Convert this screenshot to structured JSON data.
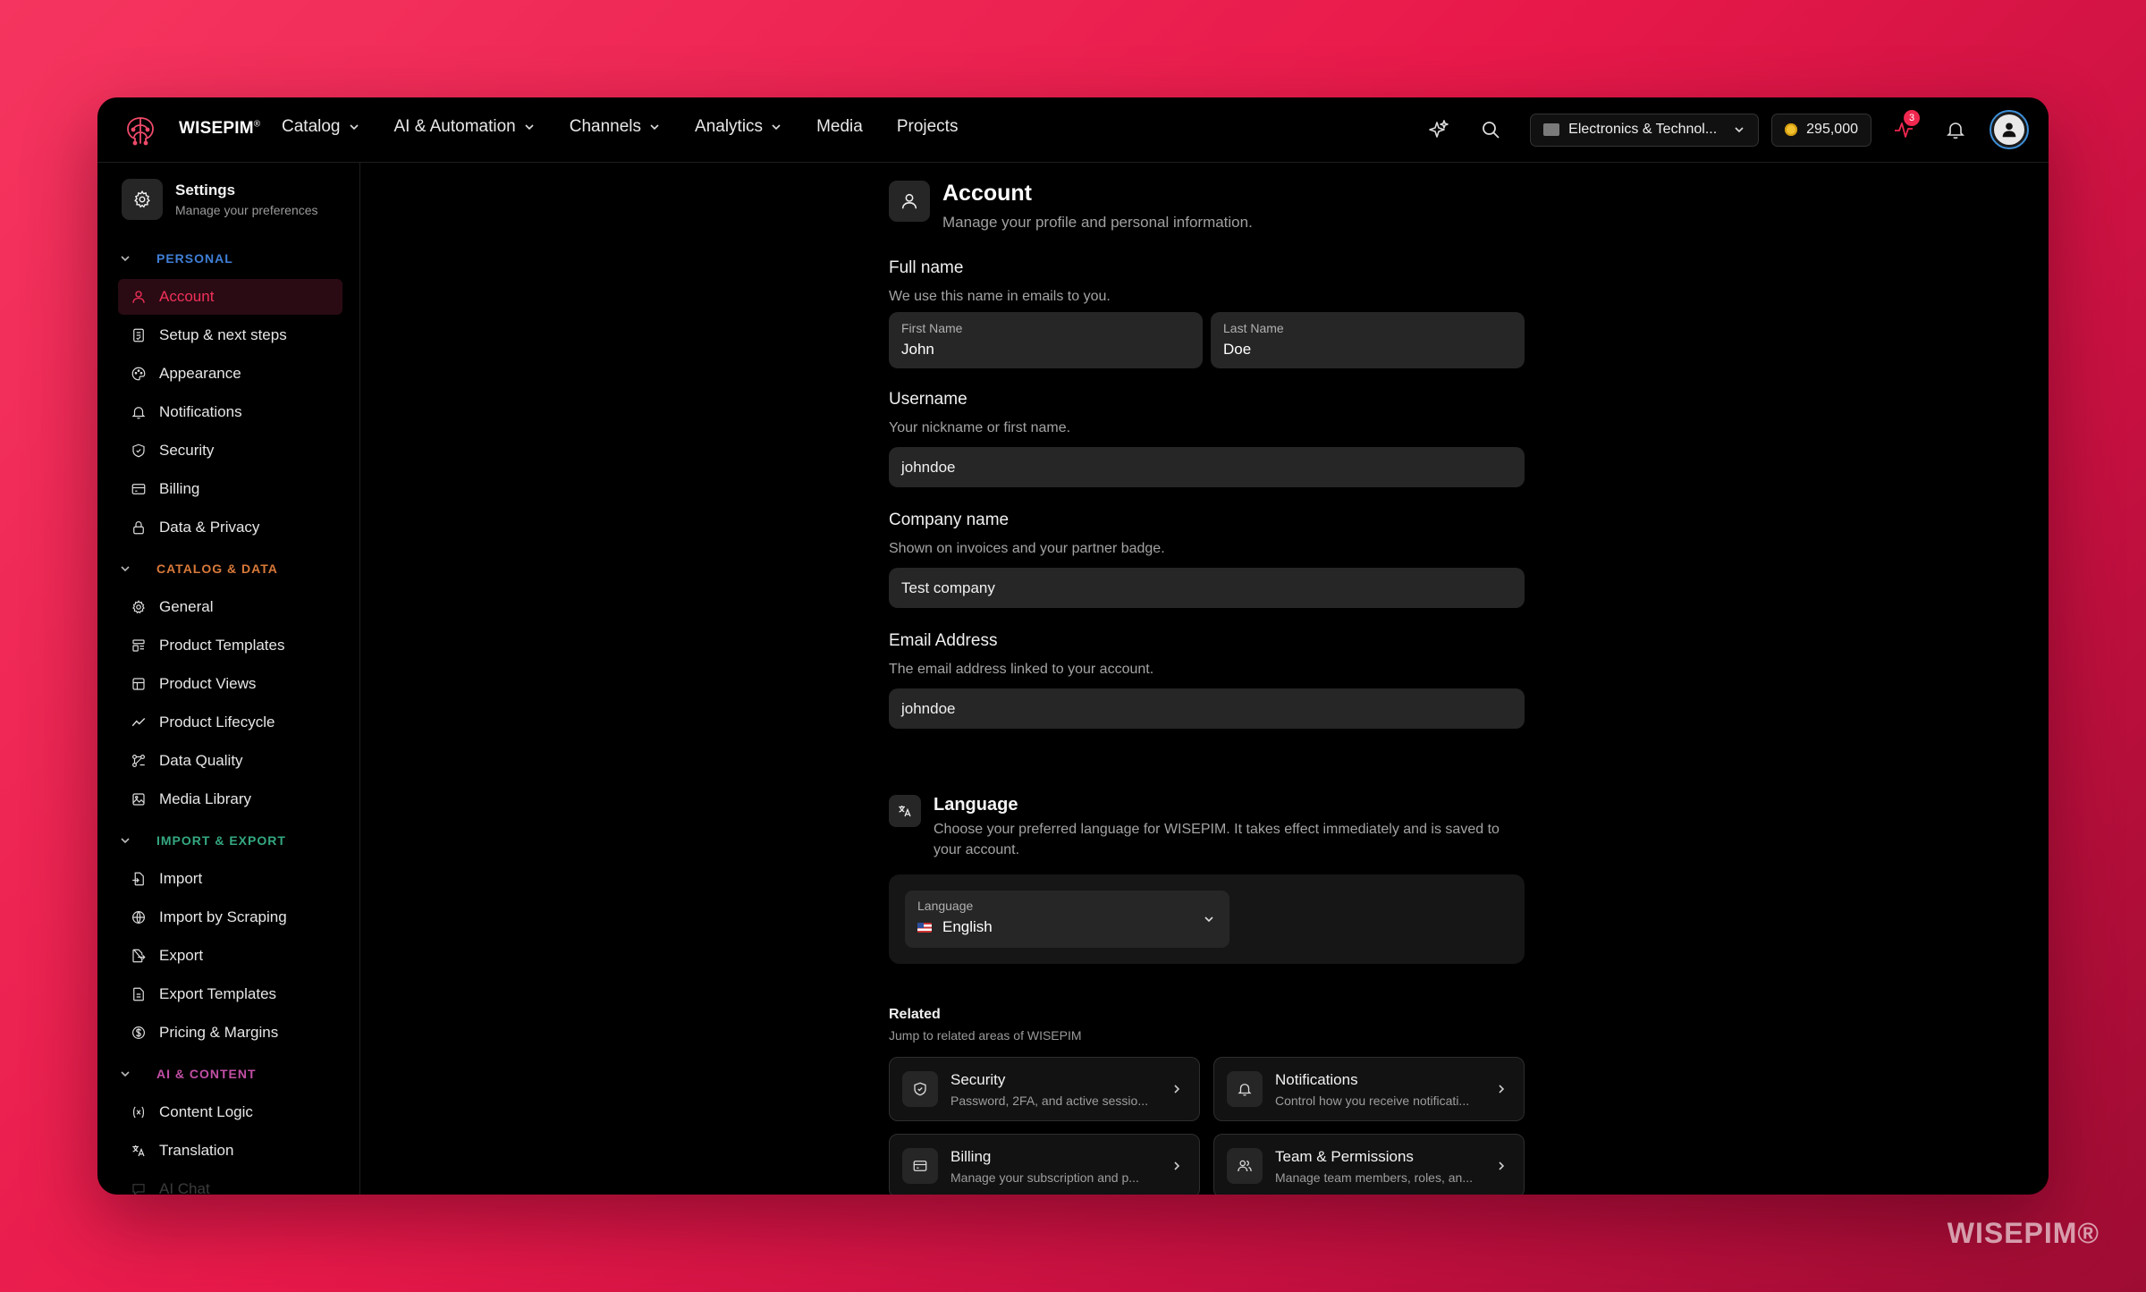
{
  "brand": {
    "name": "WISEPIM",
    "mark": "®"
  },
  "nav": [
    {
      "label": "Catalog",
      "dropdown": true
    },
    {
      "label": "AI & Automation",
      "dropdown": true
    },
    {
      "label": "Channels",
      "dropdown": true
    },
    {
      "label": "Analytics",
      "dropdown": true
    },
    {
      "label": "Media",
      "dropdown": false
    },
    {
      "label": "Projects",
      "dropdown": false
    }
  ],
  "topbar": {
    "workspace": "Electronics & Technol...",
    "credits": "295,000",
    "activity_badge": "3"
  },
  "settings": {
    "title": "Settings",
    "subtitle": "Manage your preferences"
  },
  "sections": {
    "personal": {
      "label": "PERSONAL",
      "color": "#3f7fd6",
      "items": [
        "Account",
        "Setup & next steps",
        "Appearance",
        "Notifications",
        "Security",
        "Billing",
        "Data & Privacy"
      ]
    },
    "catalog": {
      "label": "CATALOG & DATA",
      "color": "#d9793a",
      "items": [
        "General",
        "Product Templates",
        "Product Views",
        "Product Lifecycle",
        "Data Quality",
        "Media Library"
      ]
    },
    "import": {
      "label": "IMPORT & EXPORT",
      "color": "#35a882",
      "items": [
        "Import",
        "Import by Scraping",
        "Export",
        "Export Templates",
        "Pricing & Margins"
      ]
    },
    "ai": {
      "label": "AI & CONTENT",
      "color": "#c24fa6",
      "items": [
        "Content Logic",
        "Translation",
        "AI Chat"
      ]
    }
  },
  "account": {
    "title": "Account",
    "subtitle": "Manage your profile and personal information.",
    "full_name": {
      "label": "Full name",
      "help": "We use this name in emails to you.",
      "first_label": "First Name",
      "first_value": "John",
      "last_label": "Last Name",
      "last_value": "Doe"
    },
    "username": {
      "label": "Username",
      "help": "Your nickname or first name.",
      "value": "johndoe"
    },
    "company": {
      "label": "Company name",
      "help": "Shown on invoices and your partner badge.",
      "value": "Test company"
    },
    "email": {
      "label": "Email Address",
      "help": "The email address linked to your account.",
      "value": "johndoe"
    }
  },
  "language": {
    "title": "Language",
    "subtitle": "Choose your preferred language for WISEPIM. It takes effect immediately and is saved to your account.",
    "select_label": "Language",
    "selected": "English"
  },
  "related": {
    "title": "Related",
    "subtitle": "Jump to related areas of WISEPIM",
    "cards": [
      {
        "title": "Security",
        "sub": "Password, 2FA, and active sessio..."
      },
      {
        "title": "Notifications",
        "sub": "Control how you receive notificati..."
      },
      {
        "title": "Billing",
        "sub": "Manage your subscription and p..."
      },
      {
        "title": "Team & Permissions",
        "sub": "Manage team members, roles, an..."
      }
    ]
  },
  "watermark": "WISEPIM®",
  "colors": {
    "accent": "#f2305a",
    "active_bg": "#2a0b13",
    "avatar_ring": "#3d8fd8"
  }
}
